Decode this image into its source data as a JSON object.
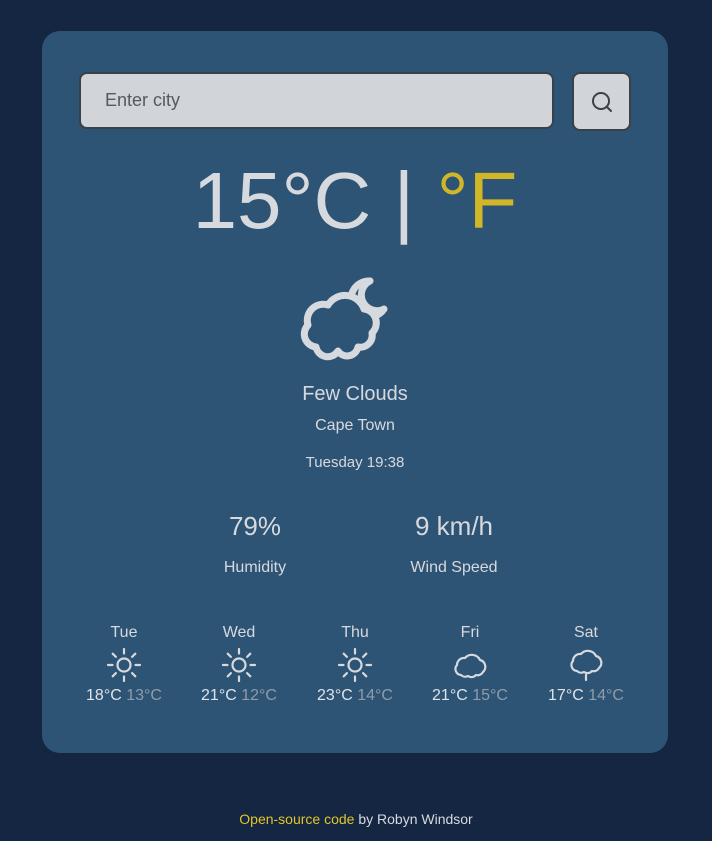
{
  "search": {
    "placeholder": "Enter city",
    "value": ""
  },
  "current": {
    "temperature": "15",
    "unit_c": "°C",
    "separator": "|",
    "unit_f": "°F",
    "icon": "few-clouds-icon",
    "condition": "Few Clouds",
    "city": "Cape Town",
    "datetime": "Tuesday 19:38"
  },
  "stats": {
    "humidity_value": "79%",
    "humidity_label": "Humidity",
    "wind_value": "9 km/h",
    "wind_label": "Wind Speed"
  },
  "forecast": [
    {
      "day": "Tue",
      "icon": "sun-icon",
      "high": "18°C",
      "low": "13°C"
    },
    {
      "day": "Wed",
      "icon": "sun-icon",
      "high": "21°C",
      "low": "12°C"
    },
    {
      "day": "Thu",
      "icon": "sun-icon",
      "high": "23°C",
      "low": "14°C"
    },
    {
      "day": "Fri",
      "icon": "cloud-icon",
      "high": "21°C",
      "low": "15°C"
    },
    {
      "day": "Sat",
      "icon": "drizzle-icon",
      "high": "17°C",
      "low": "14°C"
    }
  ],
  "footer": {
    "link_text": "Open-source code",
    "suffix": " by Robyn Windsor"
  },
  "colors": {
    "background": "#142641",
    "card": "#2e5475",
    "accent": "#d1b628",
    "text": "#d6d9de",
    "muted": "#8f9ba8"
  }
}
